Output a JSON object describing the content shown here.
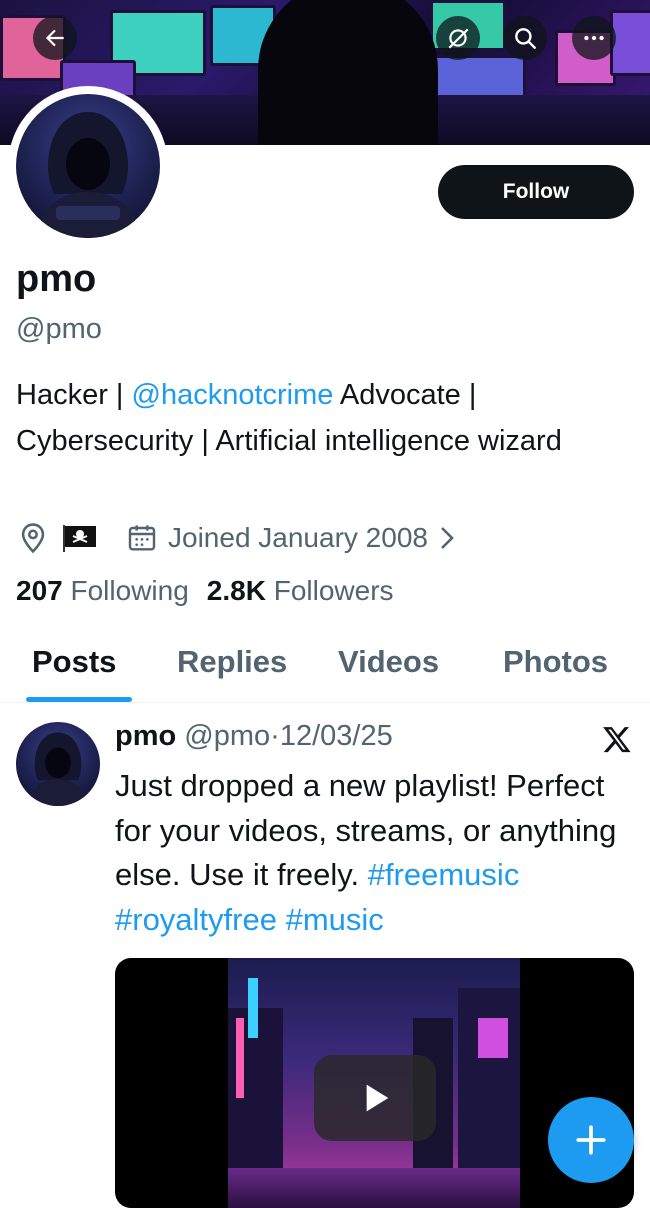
{
  "profile": {
    "name": "pmo",
    "handle": "@pmo",
    "follow_label": "Follow",
    "bio_prefix": "Hacker | ",
    "bio_link": "@hacknotcrime",
    "bio_suffix": " Advocate | Cybersecurity | Artificial intelligence wizard",
    "joined": "Joined January 2008",
    "following_count": "207",
    "following_label": "Following",
    "followers_count": "2.8K",
    "followers_label": "Followers"
  },
  "tabs": [
    "Posts",
    "Replies",
    "Videos",
    "Photos"
  ],
  "post": {
    "name": "pmo",
    "handle": "@pmo",
    "separator": "·",
    "date": "12/03/25",
    "text": "Just dropped a new playlist! Perfect for your videos, streams, or anything else. Use it freely.",
    "hashtags": "#freemusic #royaltyfree #music"
  },
  "icons": {
    "back": "back-arrow-icon",
    "grok": "grok-icon",
    "search": "search-icon",
    "more": "more-icon",
    "location": "location-pin-icon",
    "flag": "pirate-flag-icon",
    "calendar": "calendar-icon",
    "chevron": "chevron-right-icon",
    "x_logo": "x-logo-icon",
    "play": "play-icon",
    "compose": "compose-plus-icon"
  },
  "colors": {
    "accent": "#1d9bf0",
    "text": "#0f1419",
    "secondary": "#536471"
  }
}
